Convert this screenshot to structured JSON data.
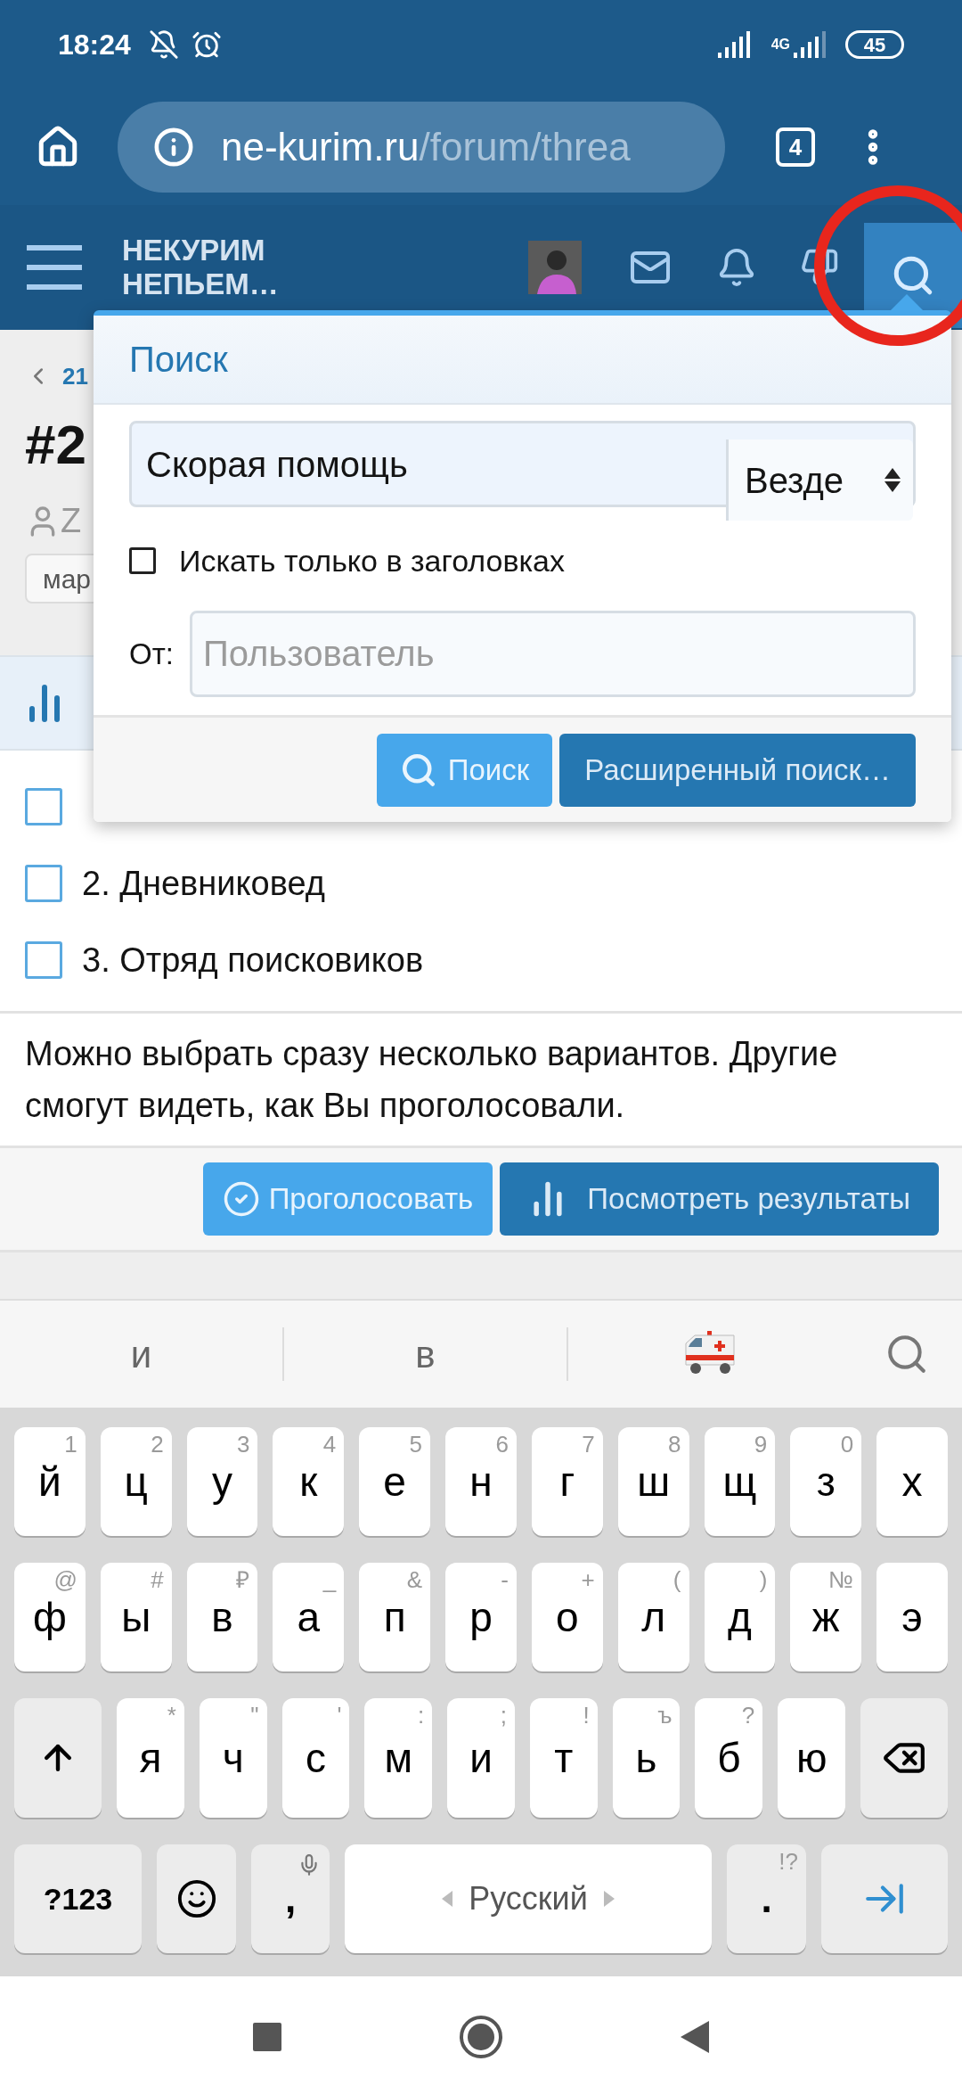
{
  "status_bar": {
    "time": "18:24",
    "network": "4G",
    "battery": "45"
  },
  "browser": {
    "url_host": "ne-kurim.ru",
    "url_path": "/forum/threa",
    "tab_count": "4"
  },
  "forum_header": {
    "logo_lines": [
      "НЕКУРИМ",
      "НЕПЬЕМ…"
    ]
  },
  "page": {
    "breadcrumb": "21",
    "title": "#2",
    "author": "Z",
    "tag": "мар"
  },
  "search_popup": {
    "title": "Поиск",
    "query": "Скорая помощь",
    "scope": "Везде",
    "titles_only": {
      "label": "Искать только в заголовках",
      "checked": false
    },
    "from_label": "От:",
    "from_placeholder": "Пользователь",
    "buttons": [
      {
        "label": "Поиск",
        "kind": "primary"
      },
      {
        "label": "Расширенный поиск…",
        "kind": "secondary"
      }
    ]
  },
  "poll": {
    "options": [
      {
        "checked": false
      },
      {
        "label": "2. Дневниковед",
        "checked": false
      },
      {
        "label": "3. Отряд поисковиков",
        "checked": false
      }
    ],
    "note": "Можно выбрать сразу несколько вариантов. Другие смогут видеть, как Вы проголосовали.",
    "buttons": [
      {
        "label": "Проголосовать",
        "kind": "vote"
      },
      {
        "label": "Посмотреть результаты",
        "kind": "results"
      }
    ]
  },
  "keyboard": {
    "suggestions": [
      {
        "kind": "word",
        "text": "и"
      },
      {
        "kind": "word",
        "text": "в"
      },
      {
        "kind": "ambulance"
      },
      {
        "kind": "search"
      }
    ],
    "rows": [
      [
        {
          "kind": "letter",
          "key": "й",
          "hint": "1"
        },
        {
          "kind": "letter",
          "key": "ц",
          "hint": "2"
        },
        {
          "kind": "letter",
          "key": "у",
          "hint": "3"
        },
        {
          "kind": "letter",
          "key": "к",
          "hint": "4"
        },
        {
          "kind": "letter",
          "key": "е",
          "hint": "5"
        },
        {
          "kind": "letter",
          "key": "н",
          "hint": "6"
        },
        {
          "kind": "letter",
          "key": "г",
          "hint": "7"
        },
        {
          "kind": "letter",
          "key": "ш",
          "hint": "8"
        },
        {
          "kind": "letter",
          "key": "щ",
          "hint": "9"
        },
        {
          "kind": "letter",
          "key": "з",
          "hint": "0"
        },
        {
          "kind": "letter",
          "key": "х"
        }
      ],
      [
        {
          "kind": "letter",
          "key": "ф",
          "hint": "@"
        },
        {
          "kind": "letter",
          "key": "ы",
          "hint": "#"
        },
        {
          "kind": "letter",
          "key": "в",
          "hint": "₽"
        },
        {
          "kind": "letter",
          "key": "а",
          "hint": "_"
        },
        {
          "kind": "letter",
          "key": "п",
          "hint": "&"
        },
        {
          "kind": "letter",
          "key": "р",
          "hint": "-"
        },
        {
          "kind": "letter",
          "key": "о",
          "hint": "+"
        },
        {
          "kind": "letter",
          "key": "л",
          "hint": "("
        },
        {
          "kind": "letter",
          "key": "д",
          "hint": ")"
        },
        {
          "kind": "letter",
          "key": "ж",
          "hint": "№"
        },
        {
          "kind": "letter",
          "key": "э"
        }
      ],
      [
        {
          "kind": "shift"
        },
        {
          "kind": "letter",
          "key": "я",
          "hint": "*"
        },
        {
          "kind": "letter",
          "key": "ч",
          "hint": "\""
        },
        {
          "kind": "letter",
          "key": "с",
          "hint": "'"
        },
        {
          "kind": "letter",
          "key": "м",
          "hint": ":"
        },
        {
          "kind": "letter",
          "key": "и",
          "hint": ";"
        },
        {
          "kind": "letter",
          "key": "т",
          "hint": "!"
        },
        {
          "kind": "letter",
          "key": "ь",
          "hint": "ъ"
        },
        {
          "kind": "letter",
          "key": "б",
          "hint": "?"
        },
        {
          "kind": "letter",
          "key": "ю"
        },
        {
          "kind": "backspace"
        }
      ]
    ],
    "bottom_row": [
      {
        "kind": "symbols",
        "key": "?123"
      },
      {
        "kind": "emoji"
      },
      {
        "kind": "comma",
        "key": ","
      },
      {
        "kind": "space",
        "key": "Русский"
      },
      {
        "kind": "period",
        "key": ".",
        "hint": "!?"
      },
      {
        "kind": "enter"
      }
    ]
  }
}
